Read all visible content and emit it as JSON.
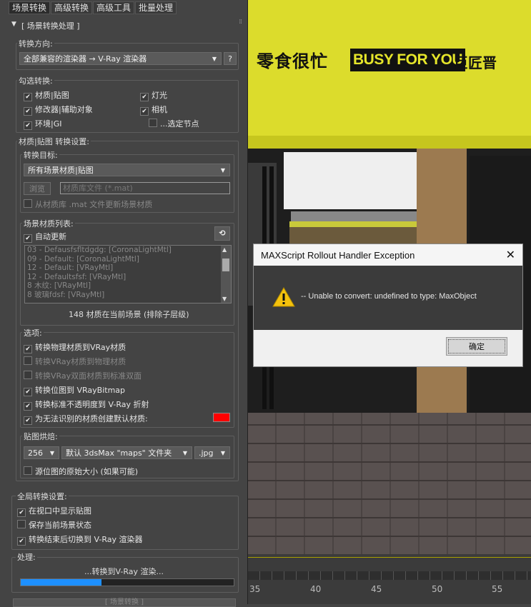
{
  "tabs": [
    "场景转换",
    "高级转换",
    "高级工具",
    "批量处理"
  ],
  "rollout_title": "[ 场景转换处理 ]",
  "direction": {
    "label": "转换方向:",
    "value": "全部兼容的渲染器 → V-Ray 渲染器",
    "help": "?"
  },
  "check_convert": {
    "label": "勾选转换:",
    "items": [
      {
        "label": "材质|贴图",
        "checked": true
      },
      {
        "label": "修改器|辅助对象",
        "checked": true
      },
      {
        "label": "环境|GI",
        "checked": true
      },
      {
        "label": "灯光",
        "checked": true
      },
      {
        "label": "相机",
        "checked": true
      },
      {
        "label": "...选定节点",
        "checked": false
      }
    ]
  },
  "material_settings": {
    "label": "材质|贴图 转换设置:",
    "target_label": "转换目标:",
    "target_value": "所有场景材质|贴图",
    "browse": "浏览",
    "mat_placeholder": "材质库文件 (*.mat)",
    "update_from_mat": "从材质库 .mat 文件更新场景材质",
    "scene_list_label": "场景材质列表:",
    "auto_update": "自动更新",
    "refresh_icon": "refresh-icon",
    "list_items": [
      "03 - Defausfsfltdgdg: [CoronaLightMtl]",
      "09 - Default: [CoronaLightMtl]",
      "12 - Default: [VRayMtl]",
      "12 - Defaultsfsf: [VRayMtl]",
      "8 木纹: [VRayMtl]",
      "8 玻璃fdsf: [VRayMtl]"
    ],
    "count_text": "148 材质在当前场景 (排除子层级)"
  },
  "options": {
    "label": "选项:",
    "items": [
      {
        "label": "转换物理材质到VRay材质",
        "checked": true,
        "disabled": false
      },
      {
        "label": "转换VRay材质到物理材质",
        "checked": false,
        "disabled": true
      },
      {
        "label": "转换VRay双面材质到标准双面",
        "checked": false,
        "disabled": true
      },
      {
        "label": "转换位图到 VRayBitmap",
        "checked": true,
        "disabled": false
      },
      {
        "label": "转换标准不透明度到 V-Ray 折射",
        "checked": true,
        "disabled": false
      },
      {
        "label": "为无法识别的材质创建默认材质:",
        "checked": true,
        "disabled": false
      }
    ],
    "default_color": "#ff0000"
  },
  "bake": {
    "label": "贴图烘焙:",
    "size": "256",
    "folder": "默认 3dsMax \"maps\" 文件夹",
    "format": ".jpg",
    "original_size": "源位图的原始大小 (如果可能)"
  },
  "global": {
    "label": "全局转换设置:",
    "items": [
      {
        "label": "在视口中显示贴图",
        "checked": true
      },
      {
        "label": "保存当前场景状态",
        "checked": false
      },
      {
        "label": "转换结束后切换到 V-Ray 渲染器",
        "checked": true
      }
    ]
  },
  "process": {
    "label": "处理:",
    "status": "...转换到V-Ray 渲染...",
    "progress": 0.38
  },
  "bottom_button": "[ 场景转换 ]",
  "viewport": {
    "sign_text_1": "零食很忙",
    "sign_text_2": "BUSY FOR YOU",
    "sign_text_3": "巨匠晋",
    "timeline_ticks": [
      "35",
      "40",
      "45",
      "50",
      "55"
    ]
  },
  "dialog": {
    "title": "MAXScript Rollout Handler Exception",
    "close": "✕",
    "message": "-- Unable to convert: undefined to type: MaxObject",
    "ok": "确定",
    "icon": "warning-icon"
  }
}
